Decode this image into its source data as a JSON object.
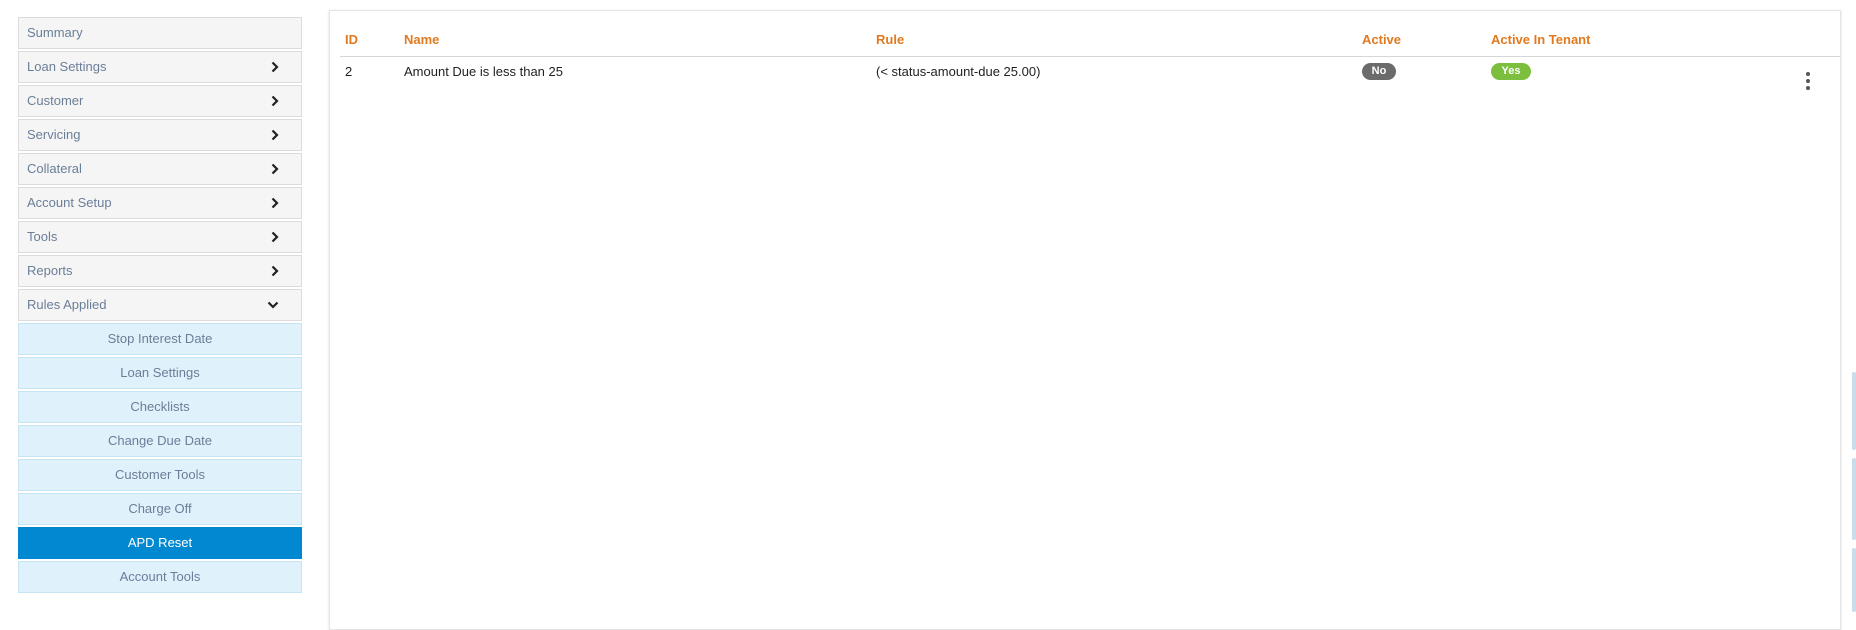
{
  "sidebar": {
    "items": [
      {
        "label": "Summary",
        "expandable": false
      },
      {
        "label": "Loan Settings",
        "expandable": true
      },
      {
        "label": "Customer",
        "expandable": true
      },
      {
        "label": "Servicing",
        "expandable": true
      },
      {
        "label": "Collateral",
        "expandable": true
      },
      {
        "label": "Account Setup",
        "expandable": true
      },
      {
        "label": "Tools",
        "expandable": true
      },
      {
        "label": "Reports",
        "expandable": true
      },
      {
        "label": "Rules Applied",
        "expandable": true,
        "expanded": true
      }
    ],
    "sub_items": [
      {
        "label": "Stop Interest Date"
      },
      {
        "label": "Loan Settings"
      },
      {
        "label": "Checklists"
      },
      {
        "label": "Change Due Date"
      },
      {
        "label": "Customer Tools"
      },
      {
        "label": "Charge Off"
      },
      {
        "label": "APD Reset",
        "active": true
      },
      {
        "label": "Account Tools"
      }
    ]
  },
  "table": {
    "headers": {
      "id": "ID",
      "name": "Name",
      "rule": "Rule",
      "active": "Active",
      "active_in_tenant": "Active In Tenant"
    },
    "rows": [
      {
        "id": "2",
        "name": "Amount Due is less than 25",
        "rule": "(< status-amount-due 25.00)",
        "active": "No",
        "active_in_tenant": "Yes"
      }
    ]
  },
  "icons": {
    "chevron_right": "chevron-right-icon",
    "chevron_down": "chevron-down-icon",
    "row_menu": "kebab-menu-icon"
  },
  "colors": {
    "header_text": "#e07a1f",
    "active_sub_item": "#0288d1",
    "badge_no": "#6b6b6b",
    "badge_yes": "#7cbf3e"
  }
}
